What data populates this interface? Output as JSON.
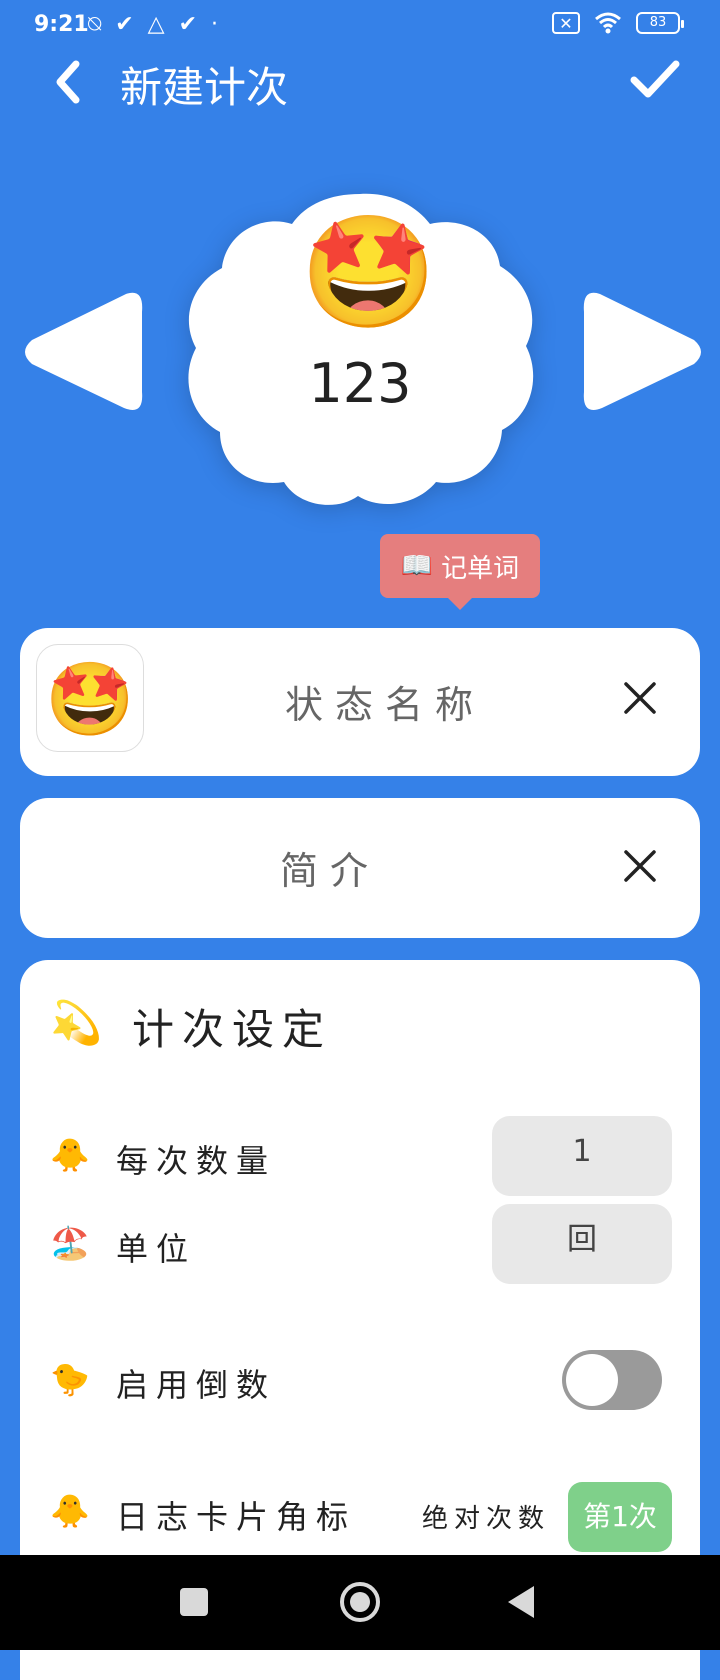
{
  "status_bar": {
    "time": "9:21",
    "left_icons": [
      "mute-icon",
      "check-icon",
      "drive-icon",
      "check-icon",
      "dot-icon"
    ],
    "battery": "83"
  },
  "header": {
    "title": "新建计次",
    "back_icon": "chevron-left-icon",
    "confirm_icon": "check-icon"
  },
  "preview": {
    "emoji": "🤩",
    "count": "123",
    "tag_icon": "📖",
    "tag_label": "记单词"
  },
  "name_field": {
    "icon_emoji": "🤩",
    "placeholder": "状态名称"
  },
  "intro_field": {
    "placeholder": "简介"
  },
  "settings": {
    "icon": "💫",
    "title": "计次设定",
    "rows": [
      {
        "icon": "🐥",
        "label": "每次数量",
        "value": "1"
      },
      {
        "icon": "🏖️",
        "label": "单位",
        "value": "回"
      },
      {
        "icon": "🐤",
        "label": "启用倒数",
        "toggle_on": false
      },
      {
        "icon": "🐥",
        "label": "日志卡片角标",
        "mode": "绝对次数",
        "badge": "第1次"
      }
    ]
  },
  "colors": {
    "background": "#3581E8",
    "tag": "#E57E7E",
    "badge": "#7FD08A"
  }
}
